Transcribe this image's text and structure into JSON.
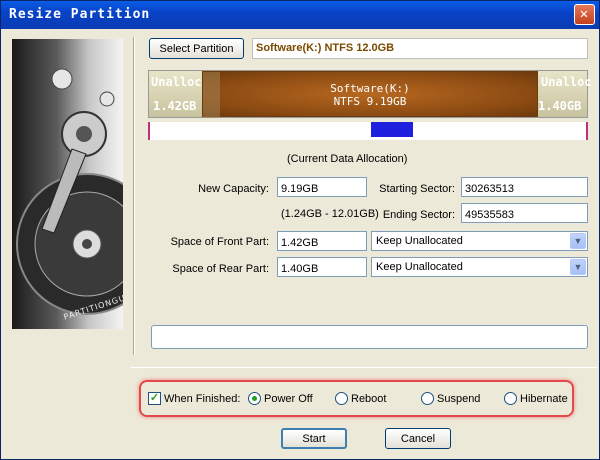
{
  "window": {
    "title": "Resize Partition",
    "close_glyph": "✕"
  },
  "side_image": {
    "brand_text": "PARTITIONGURU"
  },
  "toolbar": {
    "select_partition_label": "Select Partition",
    "partition_info": "Software(K:) NTFS 12.0GB"
  },
  "partition_bar": {
    "left_unalloc": {
      "label": "Unalloc",
      "size": "1.42GB"
    },
    "main": {
      "name": "Software(K:)",
      "detail": "NTFS 9.19GB"
    },
    "right_unalloc": {
      "label": "Unalloc",
      "size": "1.40GB"
    }
  },
  "allocation_caption": "(Current Data Allocation)",
  "form": {
    "new_capacity_label": "New Capacity:",
    "new_capacity_value": "9.19GB",
    "range_hint": "(1.24GB - 12.01GB)",
    "starting_sector_label": "Starting Sector:",
    "starting_sector_value": "30263513",
    "ending_sector_label": "Ending Sector:",
    "ending_sector_value": "49535583",
    "front_label": "Space of Front Part:",
    "front_value": "1.42GB",
    "front_option": "Keep Unallocated",
    "rear_label": "Space of Rear Part:",
    "rear_value": "1.40GB",
    "rear_option": "Keep Unallocated"
  },
  "finish": {
    "when_finished_label": "When Finished:",
    "when_finished_checked": true,
    "options": [
      "Power Off",
      "Reboot",
      "Suspend",
      "Hibernate"
    ],
    "selected": "Power Off"
  },
  "buttons": {
    "start": "Start",
    "cancel": "Cancel"
  },
  "colors": {
    "partition_main": "#8a4a12",
    "used_data": "#1f1fe0",
    "highlight": "#e04a4a",
    "titlebar": "#0843c7"
  }
}
